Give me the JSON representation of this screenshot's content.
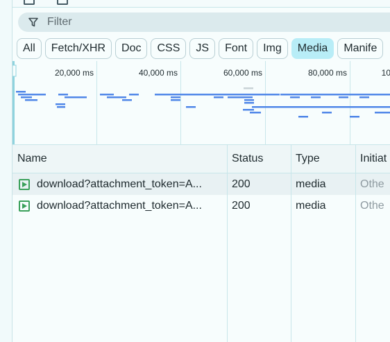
{
  "filter": {
    "placeholder": "Filter",
    "icon": "filter-icon"
  },
  "type_chips": [
    {
      "label": "All",
      "active": false
    },
    {
      "label": "Fetch/XHR",
      "active": false
    },
    {
      "label": "Doc",
      "active": false
    },
    {
      "label": "CSS",
      "active": false
    },
    {
      "label": "JS",
      "active": false
    },
    {
      "label": "Font",
      "active": false
    },
    {
      "label": "Img",
      "active": false
    },
    {
      "label": "Media",
      "active": true
    },
    {
      "label": "Manife",
      "active": false
    }
  ],
  "overview": {
    "tick_labels": [
      "20,000 ms",
      "40,000 ms",
      "60,000 ms",
      "80,000 ms",
      "10"
    ],
    "bar_color": "#4f86e8"
  },
  "table": {
    "columns": [
      "Name",
      "Status",
      "Type",
      "Initiat"
    ],
    "rows": [
      {
        "name": "download?attachment_token=A...",
        "status": "200",
        "type": "media",
        "initiator": "Othe"
      },
      {
        "name": "download?attachment_token=A...",
        "status": "200",
        "type": "media",
        "initiator": "Othe"
      }
    ]
  },
  "colors": {
    "accent_chip": "#b8edf7",
    "media_icon": "#3aa05a",
    "grid_line": "#c8e6ea"
  }
}
